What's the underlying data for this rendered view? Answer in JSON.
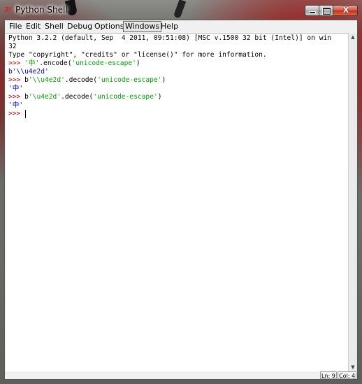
{
  "window": {
    "title": "Python Shell",
    "app_icon": "7⁄",
    "close_glyph": "X"
  },
  "menu": [
    {
      "label": "File",
      "id": "file"
    },
    {
      "label": "Edit",
      "id": "edit"
    },
    {
      "label": "Shell",
      "id": "shell"
    },
    {
      "label": "Debug",
      "id": "debug"
    },
    {
      "label": "Options",
      "id": "options"
    },
    {
      "label": "Windows",
      "id": "windows",
      "active": true
    },
    {
      "label": "Help",
      "id": "help"
    }
  ],
  "shell": {
    "banner_line1": "Python 3.2.2 (default, Sep  4 2011, 09:51:08) [MSC v.1500 32 bit (Intel)] on win",
    "banner_line2": "32",
    "banner_line3": "Type \"copyright\", \"credits\" or \"license()\" for more information.",
    "prompt": ">>> ",
    "cmd1_str": "'中'",
    "cmd1_call": ".encode(",
    "cmd1_arg": "'unicode-escape'",
    "cmd1_close": ")",
    "out1": "b'\\\\u4e2d'",
    "cmd2_pre": "b",
    "cmd2_str": "'\\\\u4e2d'",
    "cmd2_call": ".decode(",
    "cmd2_arg": "'unicode-escape'",
    "cmd2_close": ")",
    "out2": "'中'",
    "cmd3_pre": "b",
    "cmd3_str": "'\\u4e2d'",
    "cmd3_call": ".decode(",
    "cmd3_arg": "'unicode-escape'",
    "cmd3_close": ")",
    "out3": "'中'"
  },
  "status": {
    "line": "Ln: 9",
    "col": "Col: 4"
  },
  "colors": {
    "prompt": "#c00000",
    "string": "#00a000",
    "output": "#0000c0"
  },
  "icons": {
    "scroll_up": "triangle-up-icon",
    "scroll_down": "triangle-down-icon",
    "minimize": "minimize-icon",
    "maximize": "maximize-icon",
    "close": "close-icon"
  }
}
